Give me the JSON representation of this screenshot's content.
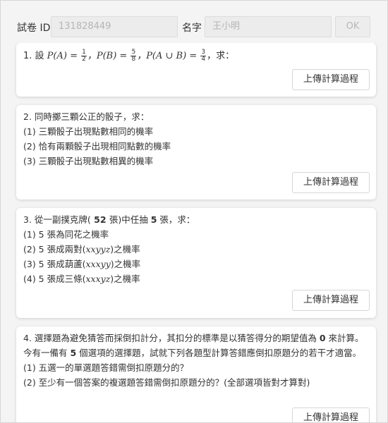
{
  "header": {
    "exam_id_label": "試卷 ID",
    "exam_id_value": "131828449",
    "name_label": "名字",
    "name_value": "王小明",
    "ok_label": "OK"
  },
  "upload_label": "上傳計算過程",
  "q1": {
    "prefix": "1. 設 ",
    "pA": "P(A) = ",
    "f1": [
      "1",
      "2"
    ],
    "pB": "，P(B) = ",
    "f2": [
      "5",
      "8"
    ],
    "pAB": "，P(A ∪ B) = ",
    "f3": [
      "3",
      "4"
    ],
    "suffix": "，求："
  },
  "q2": {
    "lines": [
      "2. 同時擲三顆公正的骰子，求：",
      "(1) 三顆骰子出現點數相同的機率",
      "(2) 恰有兩顆骰子出現相同點數的機率",
      "(3) 三顆骰子出現點數相異的機率"
    ]
  },
  "q3": {
    "l0a": "3. 從一副撲克牌(",
    "l0n": " 52 ",
    "l0b": "張)中任抽 ",
    "l0c": "5",
    "l0d": " 張，求：",
    "l1": "(1) 5 張為同花之機率",
    "l2a": "(2) 5 張成兩對(",
    "l2m": "xxyyz",
    "l2b": ")之機率",
    "l3a": "(3) 5 張成葫蘆(",
    "l3m": "xxxyy",
    "l3b": ")之機率",
    "l4a": "(4) 5 張成三條(",
    "l4m": "xxxyz",
    "l4b": ")之機率"
  },
  "q4": {
    "p1a": "4. 選擇題為避免猜答而採倒扣計分，其扣分的標準是以猜答得分的期望值為 ",
    "p1b": "0",
    "p1c": " 來計算。今有一備有 ",
    "p1d": "5",
    "p1e": " 個選項的選擇題，試就下列各題型計算答錯應倒扣原題分的若干才適當。",
    "l1": "(1) 五選一的單選題答錯需倒扣原題分的？",
    "l2": "(2) 至少有一個答案的複選題答錯需倒扣原題分的？(全部選項皆對才算對)"
  }
}
